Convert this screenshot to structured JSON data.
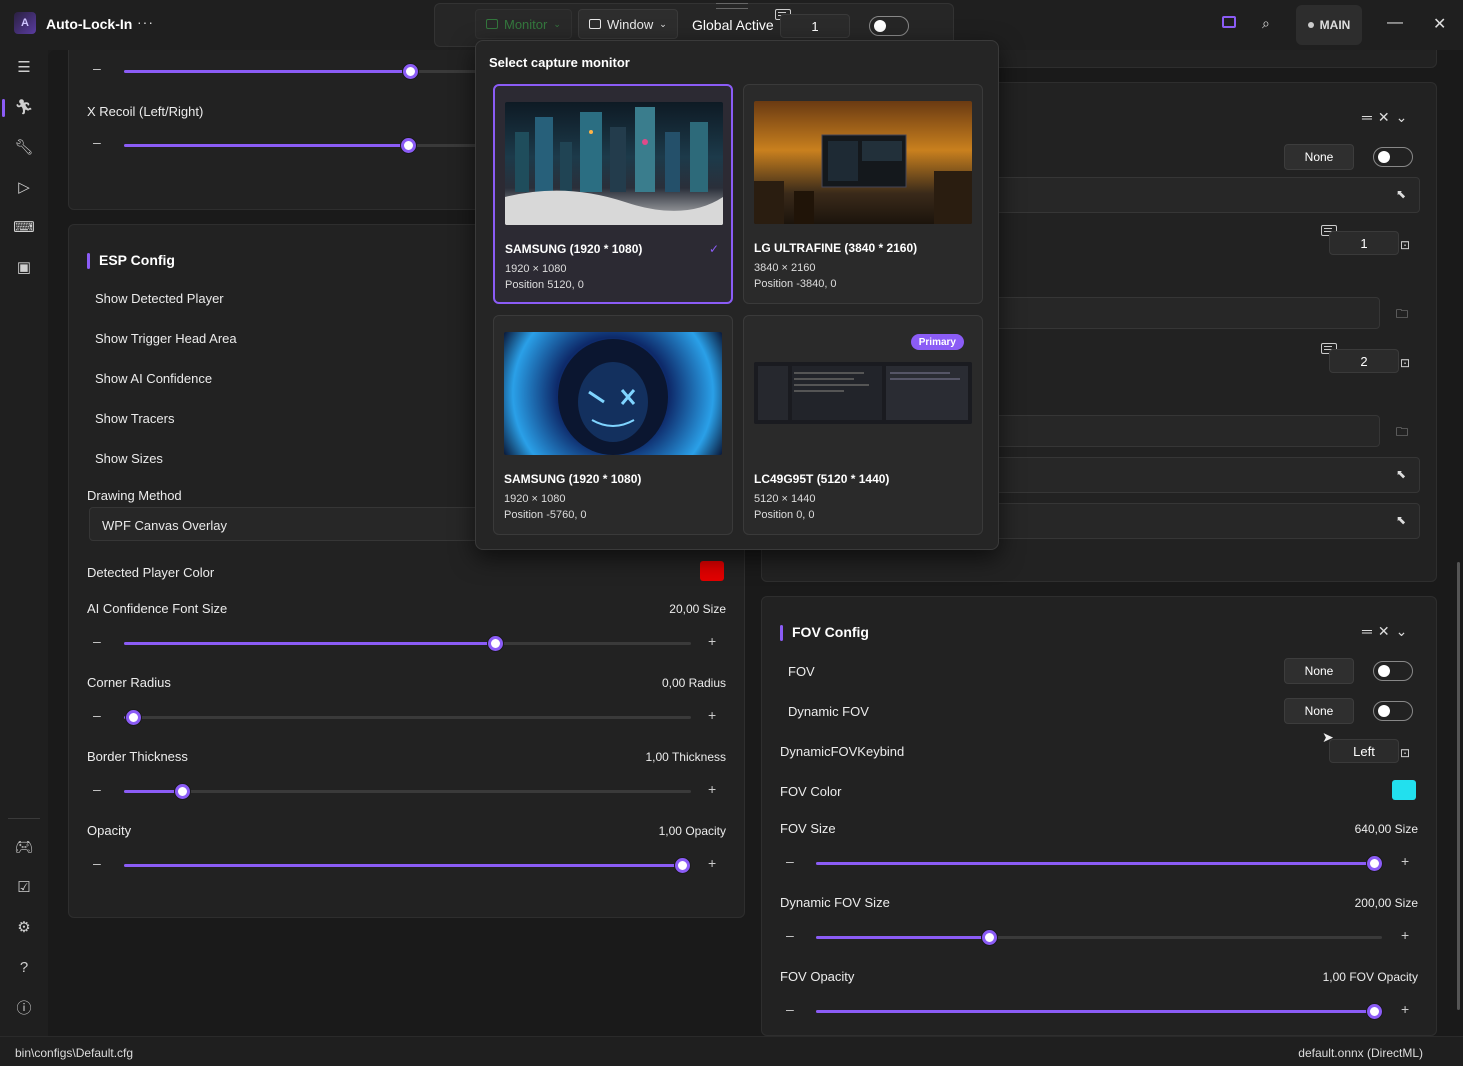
{
  "app": {
    "logo": "A",
    "title": "Auto-Lock-In",
    "menu": "···"
  },
  "toolbar": {
    "monitor_label": "Monitor",
    "window_label": "Window",
    "global_active_label": "Global Active",
    "global_active_key": "1",
    "main_label": "MAIN"
  },
  "sidebar": {
    "icons": [
      "menu-icon",
      "aim-icon",
      "wrench-icon",
      "play-icon",
      "keyboard-icon",
      "model-icon",
      "gamepad-icon",
      "checklist-icon",
      "gear-icon",
      "help-icon",
      "info-icon"
    ]
  },
  "left_top": {
    "x_recoil_label": "X Recoil (Left/Right)"
  },
  "esp": {
    "title": "ESP Config",
    "toggles": [
      "Show Detected Player",
      "Show Trigger Head Area",
      "Show AI Confidence",
      "Show Tracers",
      "Show Sizes"
    ],
    "drawing_method_label": "Drawing Method",
    "drawing_method_value": "WPF Canvas Overlay",
    "detected_color_label": "Detected Player Color",
    "detected_color": "#e30000",
    "sliders": [
      {
        "label": "AI Confidence Font Size",
        "value_text": "20,00 Size",
        "fraction": 0.66
      },
      {
        "label": "Corner Radius",
        "value_text": "0,00 Radius",
        "fraction": 0.0
      },
      {
        "label": "Border Thickness",
        "value_text": "1,00 Thickness",
        "fraction": 0.1
      },
      {
        "label": "Opacity",
        "value_text": "1,00 Opacity",
        "fraction": 1.0
      }
    ]
  },
  "right_top": {
    "none_label": "None",
    "key1": "1",
    "key2": "2"
  },
  "fov": {
    "title": "FOV Config",
    "fov_label": "FOV",
    "fov_key": "None",
    "dynamic_label": "Dynamic FOV",
    "dynamic_key": "None",
    "keybind_label": "DynamicFOVKeybind",
    "keybind_value": "Left",
    "color_label": "FOV Color",
    "color": "#22e0ee",
    "sliders": [
      {
        "label": "FOV Size",
        "value_text": "640,00 Size",
        "fraction": 1.0
      },
      {
        "label": "Dynamic FOV Size",
        "value_text": "200,00 Size",
        "fraction": 0.31
      },
      {
        "label": "FOV Opacity",
        "value_text": "1,00 FOV Opacity",
        "fraction": 1.0
      }
    ]
  },
  "popup": {
    "title": "Select capture monitor",
    "monitors": [
      {
        "name": "SAMSUNG (1920 * 1080)",
        "res": "1920 × 1080",
        "pos": "Position 5120, 0",
        "selected": true,
        "primary": false
      },
      {
        "name": "LG ULTRAFINE (3840 * 2160)",
        "res": "3840 × 2160",
        "pos": "Position -3840, 0",
        "selected": false,
        "primary": false
      },
      {
        "name": "SAMSUNG (1920 * 1080)",
        "res": "1920 × 1080",
        "pos": "Position -5760, 0",
        "selected": false,
        "primary": false
      },
      {
        "name": "LC49G95T (5120 * 1440)",
        "res": "5120 × 1440",
        "pos": "Position 0, 0",
        "selected": false,
        "primary": true
      }
    ],
    "primary_label": "Primary"
  },
  "status": {
    "config_path": "bin\\configs\\Default.cfg",
    "model": "default.onnx (DirectML)"
  },
  "colors": {
    "accent": "#8b5cf6",
    "monitor_green": "#3fb950"
  }
}
